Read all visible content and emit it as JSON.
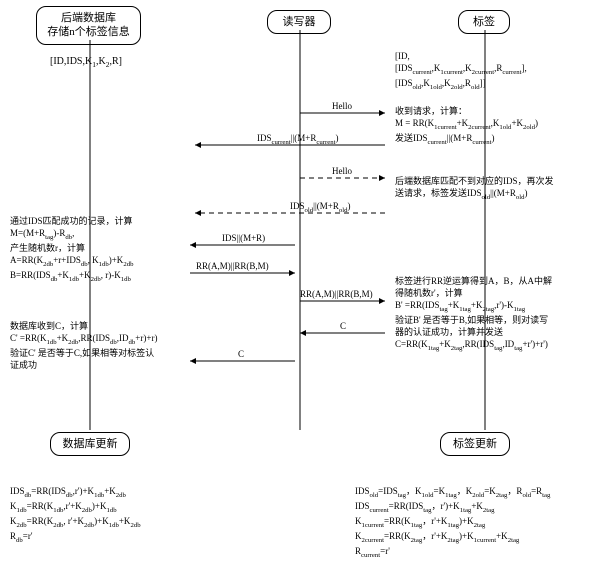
{
  "headers": {
    "db": "后端数据库\n存储n个标签信息",
    "rw": "读写器",
    "tag": "标签"
  },
  "db_top": "[ID,IDS,K₁,K₂,R]",
  "tag_top": "[ID,\n[IDS_current,K_1current,K_2current,R_current],\n[IDS_old,K_1old,K_2old,R_old]]",
  "arrows": {
    "hello1": "Hello",
    "ids_cur": "IDS_current||(M+R_current)",
    "hello2": "Hello",
    "ids_old": "IDS_old||(M+R_old)",
    "ids_mr": "IDS||(M+R)",
    "rr_ab_1": "RR(A,M)||RR(B,M)",
    "rr_ab_2": "RR(A,M)||RR(B,M)",
    "c1": "C",
    "c2": "C"
  },
  "tag_calc1": "收到请求，计算：\nM = RR(K_1current+K_2current,K_1old+K_2old)\n发送IDS_current||(M+R_current)",
  "tag_retry": "后端数据库匹配不到对应的IDS，再次发\n送请求，标签发送IDS_old||(M+R_old)",
  "db_calc1": "通过IDS匹配成功的记录，计算\nM=(M+R_tag)-R_db,\n产生随机数r，计算\nA=RR(K_2db+r+IDS_db, K_1db)+K_2db\nB=RR(IDS_db+K_1db+K_2db, r)-K_1db",
  "tag_calc2": "标签进行RR逆运算得到A，B，从A中解\n得随机数r'，计算\nB' =RR(IDS_tag+K_1tag+K_2tag,r')-K_1tag\n验证B' 是否等于B,如果相等，则对读写\n器的认证成功，计算并发送\nC=RR(K_1tag+K_2tag,RR(IDS_tag,ID_tag+r')+r')",
  "db_calc2": "数据库收到C，计算\nC' =RR(K_1db+K_2db,RR(IDS_db,ID_db+r)+r)\n验证C' 是否等于C,如果相等对标签认\n证成功",
  "db_update_title": "数据库更新",
  "db_update": "IDS_db=RR(IDS_db,r')+K_1db+K_2db\nK_1db=RR(K_1db,r'+K_2db)+K_1db\nK_2db=RR(K_2db, r'+K_2db)+K_1db+K_2db\nR_db=r'",
  "tag_update_title": "标签更新",
  "tag_update": "IDS_old=IDS_tag，K_1old=K_1tag，K_2old=K_2tag，R_old=R_tag\nIDS_current=RR(IDS_tag，r')+K_1tag+K_2tag\nK_1current=RR(K_1tag，r'+K_1tag)+K_2tag\nK_2current=RR(K_2tag，r'+K_2tag)+K_1current+K_2tag\nR_current=r'"
}
